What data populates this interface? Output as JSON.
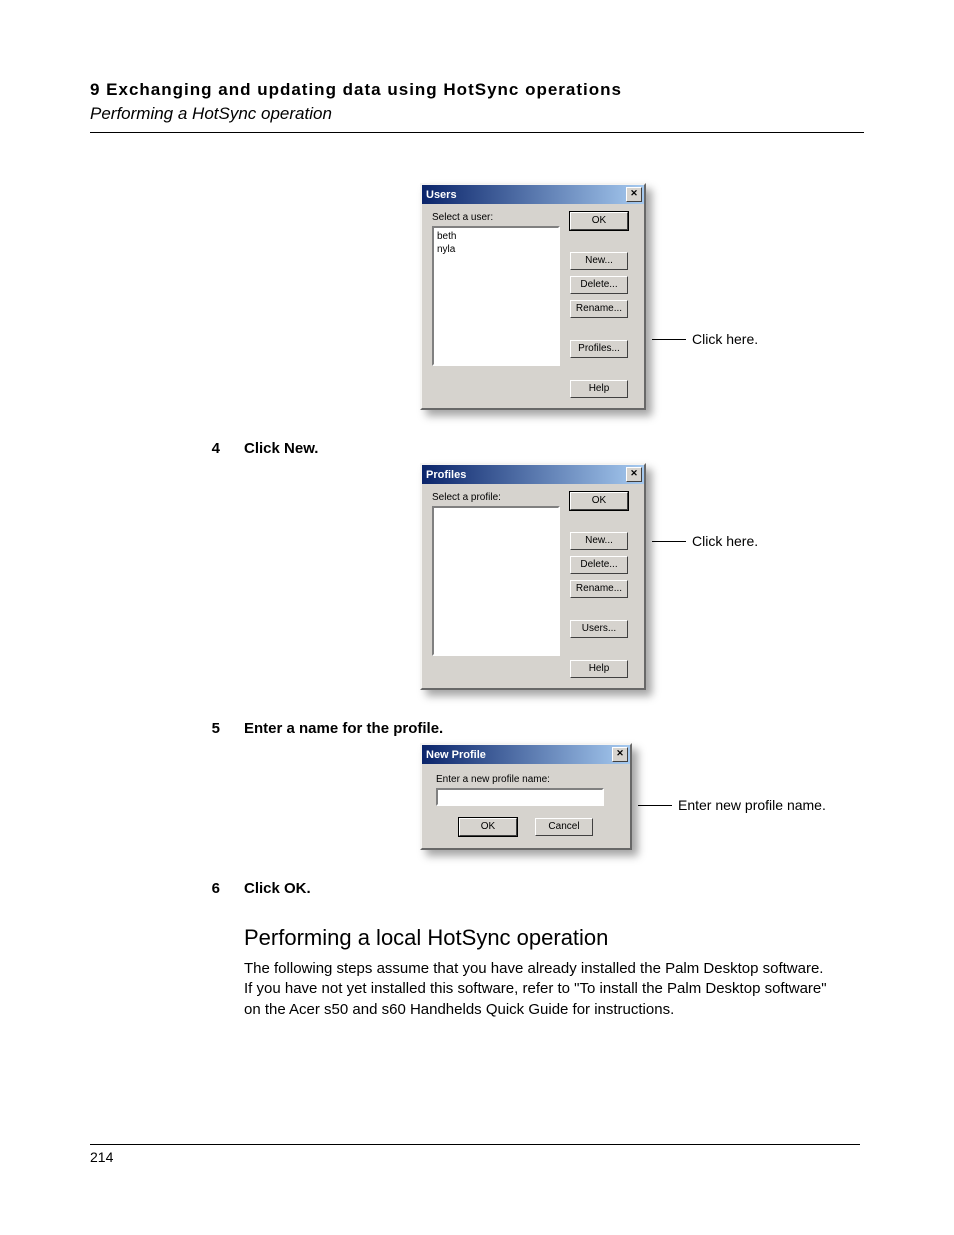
{
  "header": {
    "chapter": "9 Exchanging and updating data using HotSync operations",
    "section": "Performing a HotSync operation"
  },
  "users_dialog": {
    "title": "Users",
    "prompt": "Select a user:",
    "items": [
      "beth",
      "nyla"
    ],
    "buttons": {
      "ok": "OK",
      "new": "New...",
      "delete": "Delete...",
      "rename": "Rename...",
      "profiles": "Profiles...",
      "help": "Help"
    },
    "callout": "Click here."
  },
  "step4": {
    "num": "4",
    "text": "Click New."
  },
  "profiles_dialog": {
    "title": "Profiles",
    "prompt": "Select a profile:",
    "buttons": {
      "ok": "OK",
      "new": "New...",
      "delete": "Delete...",
      "rename": "Rename...",
      "users": "Users...",
      "help": "Help"
    },
    "callout": "Click here."
  },
  "step5": {
    "num": "5",
    "text": "Enter a name for the profile."
  },
  "new_profile_dialog": {
    "title": "New Profile",
    "prompt": "Enter a new profile name:",
    "buttons": {
      "ok": "OK",
      "cancel": "Cancel"
    },
    "callout": "Enter new profile name."
  },
  "step6": {
    "num": "6",
    "text": "Click OK."
  },
  "section2": {
    "heading": "Performing a local HotSync operation",
    "body": "The following steps assume that you have already installed the Palm Desktop software. If you have not yet installed this software, refer to \"To install the Palm Desktop software\" on the Acer s50 and s60 Handhelds Quick Guide for instructions."
  },
  "page_number": "214"
}
